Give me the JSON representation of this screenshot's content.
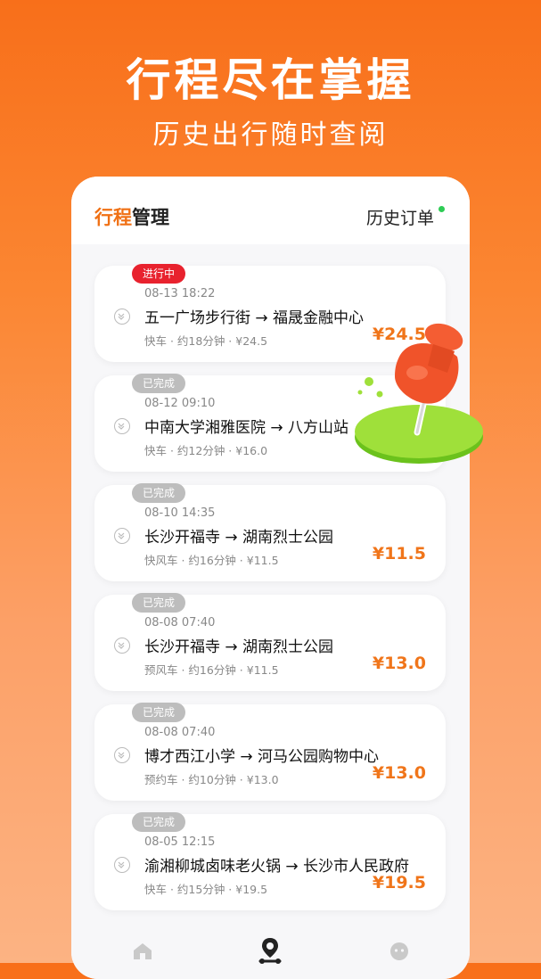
{
  "promo": {
    "title": "行程尽在掌握",
    "subtitle": "历史出行随时查阅"
  },
  "card": {
    "title_accent": "行程",
    "title_rest": "管理",
    "history_link": "历史订单"
  },
  "trips": [
    {
      "badge": "进行中",
      "active": true,
      "time": "08-13 18:22",
      "route": "五一广场步行街 → 福晟金融中心",
      "meta": "快车 · 约18分钟 · ¥24.5",
      "price": "¥24.5"
    },
    {
      "badge": "已完成",
      "active": false,
      "time": "08-12 09:10",
      "route": "中南大学湘雅医院 → 八方山站",
      "meta": "快车 · 约12分钟 · ¥16.0",
      "price": ""
    },
    {
      "badge": "已完成",
      "active": false,
      "time": "08-10 14:35",
      "route": "长沙开福寺 → 湖南烈士公园",
      "meta": "快风车 · 约16分钟 · ¥11.5",
      "price": "¥11.5"
    },
    {
      "badge": "已完成",
      "active": false,
      "time": "08-08 07:40",
      "route": "长沙开福寺 → 湖南烈士公园",
      "meta": "预风车 · 约16分钟 · ¥11.5",
      "price": "¥13.0"
    },
    {
      "badge": "已完成",
      "active": false,
      "time": "08-08 07:40",
      "route": "博才西江小学 → 河马公园购物中心",
      "meta": "预约车 · 约10分钟 · ¥13.0",
      "price": "¥13.0"
    },
    {
      "badge": "已完成",
      "active": false,
      "time": "08-05 12:15",
      "route": "渝湘柳城卤味老火锅 → 长沙市人民政府",
      "meta": "快车 · 约15分钟 · ¥19.5",
      "price": "¥19.5"
    }
  ],
  "tabs": [
    {
      "icon": "home-icon"
    },
    {
      "icon": "route-pin-icon"
    },
    {
      "icon": "profile-icon"
    }
  ],
  "colors": {
    "accent": "#f07014",
    "active_badge": "#e8222e",
    "done_badge": "#bdbdbd"
  }
}
